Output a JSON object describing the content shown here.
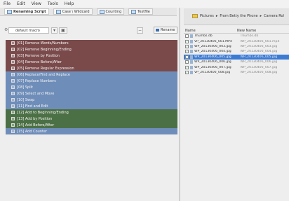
{
  "menu": [
    "File",
    "Edit",
    "View",
    "Tools",
    "Help"
  ],
  "tabs": [
    {
      "label": "Renaming Script",
      "icon": "script-icon",
      "active": true
    },
    {
      "label": "Case \\ Wildcard",
      "icon": "case-icon",
      "active": false
    },
    {
      "label": "Counting",
      "icon": "counting-icon",
      "active": false
    },
    {
      "label": "Textfile",
      "icon": "textfile-icon",
      "active": false
    }
  ],
  "toolbar": {
    "preset_value": "default macro",
    "rename_label": "Rename"
  },
  "groups": [
    {
      "color": "#7a4a4b",
      "rules": [
        "[01] Remove Words/Numbers",
        "[02] Remove Beginning/Ending",
        "[03] Remove by Position",
        "[04] Remove Before/After",
        "[05] Remove Regular Expression"
      ]
    },
    {
      "color": "#6e8db9",
      "rules": [
        "[06] Replace/Find and Replace",
        "[07] Replace Numbers",
        "[08] Split",
        "[09] Select and Move",
        "[10] Swap",
        "[11] Find and Edit"
      ]
    },
    {
      "color": "#4c7045",
      "rules": [
        "[12] Add to Beginning/Ending",
        "[13] Add by Position",
        "[14] Add Before/After"
      ]
    },
    {
      "color": "#6e8db9",
      "rules": [
        "[15] Add Counter"
      ]
    }
  ],
  "right": {
    "breadcrumb": [
      "Pictures",
      "From Betty the Phone",
      "Camera Rol"
    ],
    "columns": {
      "name": "Name",
      "new_name": "New Name"
    },
    "files": [
      {
        "name": "Thumbs.db",
        "new": "Thumbs.db",
        "checked": false,
        "selected": false
      },
      {
        "name": "VP_20130406_001.MP4",
        "new": "WP_20130406_001.mp4",
        "checked": true,
        "selected": false
      },
      {
        "name": "WP_20130406_003.jpg",
        "new": "WP_20130406_003.jpg",
        "checked": true,
        "selected": false
      },
      {
        "name": "WP_20130406_004.jpg",
        "new": "WP_20130406_004.jpg",
        "checked": true,
        "selected": false
      },
      {
        "name": "WP_20130406_005.jpg",
        "new": "WP_20130406_005.jpg",
        "checked": true,
        "selected": true
      },
      {
        "name": "WP_20130406_006.jpg",
        "new": "WP_20130406_006.jpg",
        "checked": true,
        "selected": false
      },
      {
        "name": "WP_20130406_007.jpg",
        "new": "WP_20130406_007.jpg",
        "checked": true,
        "selected": false
      },
      {
        "name": "VP_20130406_008.jpg",
        "new": "WP_20130406_008.jpg",
        "checked": true,
        "selected": false
      }
    ]
  }
}
